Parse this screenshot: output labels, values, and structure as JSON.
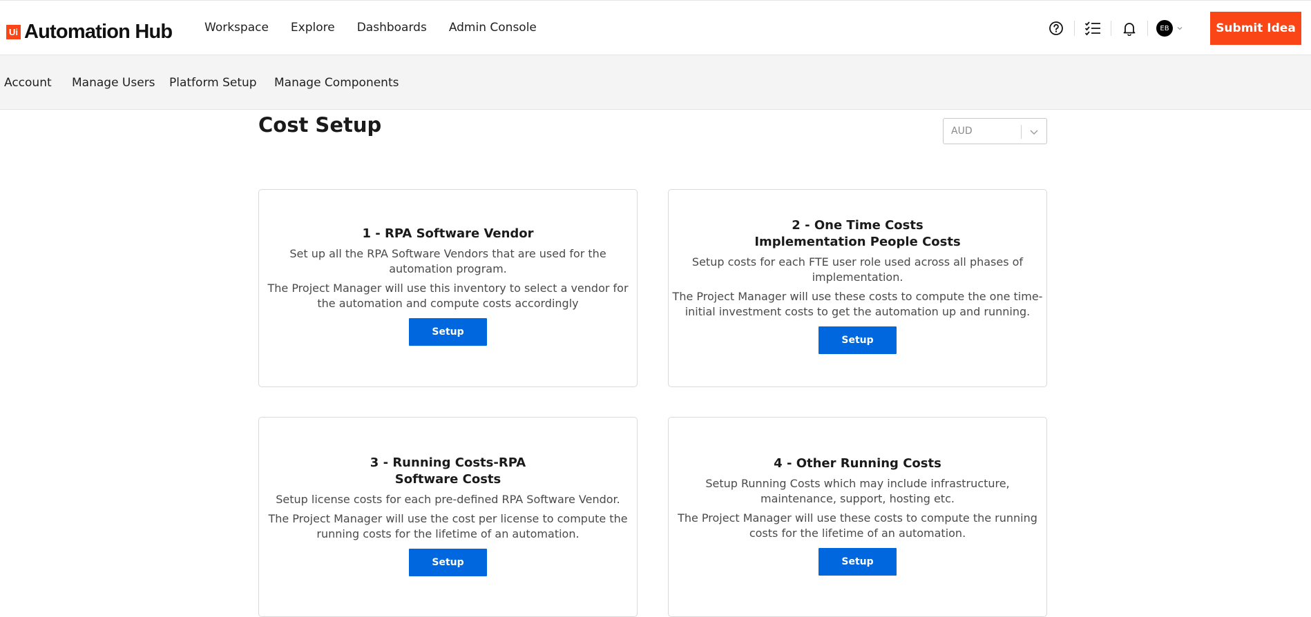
{
  "app": {
    "logo_mark": "Ui",
    "title": "Automation Hub",
    "brand_color": "#fa4616"
  },
  "main_nav": [
    "Workspace",
    "Explore",
    "Dashboards",
    "Admin Console"
  ],
  "header_icons": [
    "help-icon",
    "task-list-icon",
    "bell-icon"
  ],
  "user": {
    "initials": "EB"
  },
  "submit_label": "Submit Idea",
  "sub_nav": [
    "Account",
    "Manage Users",
    "Platform Setup",
    "Manage Components"
  ],
  "page_title": "Cost Setup",
  "currency": {
    "selected": "AUD"
  },
  "cards": [
    {
      "title_lines": [
        "1 - RPA Software Vendor"
      ],
      "desc1": [
        "Set up all the RPA Software Vendors that are used for the",
        "automation program."
      ],
      "desc2": [
        "The Project Manager will use this inventory to select a vendor for",
        "the automation and compute costs accordingly"
      ],
      "button": "Setup"
    },
    {
      "title_lines": [
        "2 - One Time Costs",
        "Implementation People Costs"
      ],
      "desc1": [
        "Setup costs for each FTE user role used across all phases of",
        "implementation."
      ],
      "desc2": [
        "The Project Manager will use these costs to compute the one time-",
        "initial investment costs to get the automation up and running."
      ],
      "button": "Setup"
    },
    {
      "title_lines": [
        "3 - Running Costs-RPA",
        "Software Costs"
      ],
      "desc1": [
        "Setup license costs for each pre-defined RPA Software Vendor."
      ],
      "desc2": [
        "The Project Manager will use the cost per license to compute the",
        "running costs for the lifetime of an automation."
      ],
      "button": "Setup"
    },
    {
      "title_lines": [
        "4 - Other Running Costs"
      ],
      "desc1": [
        "Setup Running Costs which may include infrastructure,",
        "maintenance, support, hosting etc."
      ],
      "desc2": [
        "The Project Manager will use these costs to compute the running",
        "costs for the lifetime of an automation."
      ],
      "button": "Setup"
    }
  ]
}
